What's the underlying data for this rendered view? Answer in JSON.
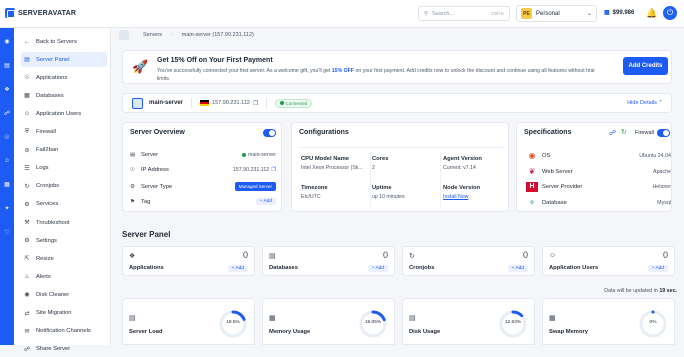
{
  "brand": {
    "name": "SERVERAVATAR",
    "accent": "#1d5bf5"
  },
  "topbar": {
    "search_placeholder": "Search...",
    "search_shortcut": "Ctrl+K",
    "account_initials": "PE",
    "account_name": "Personal",
    "credit": "$99.986"
  },
  "rail_icons": [
    "dashboard-icon",
    "servers-icon",
    "apps-icon",
    "git-icon",
    "globe-icon",
    "team-icon",
    "billing-icon",
    "integration-icon",
    "support-icon"
  ],
  "nav": [
    {
      "label": "Back to Servers",
      "icon": "arrow-left-icon"
    },
    {
      "label": "Server Panel",
      "icon": "server-icon",
      "active": true
    },
    {
      "label": "Applications",
      "icon": "globe-icon"
    },
    {
      "label": "Databases",
      "icon": "database-icon"
    },
    {
      "label": "Application Users",
      "icon": "users-icon"
    },
    {
      "label": "Firewall",
      "icon": "shield-icon"
    },
    {
      "label": "Fail2ban",
      "icon": "ban-icon"
    },
    {
      "label": "Logs",
      "icon": "logs-icon"
    },
    {
      "label": "Cronjobs",
      "icon": "refresh-icon"
    },
    {
      "label": "Services",
      "icon": "gear-icon"
    },
    {
      "label": "Troubleshoot",
      "icon": "wrench-icon"
    },
    {
      "label": "Settings",
      "icon": "settings-icon"
    },
    {
      "label": "Resize",
      "icon": "resize-icon"
    },
    {
      "label": "Alerts",
      "icon": "bell-icon"
    },
    {
      "label": "Disk Cleaner",
      "icon": "disk-icon"
    },
    {
      "label": "Site Migration",
      "icon": "migration-icon"
    },
    {
      "label": "Notification Channels",
      "icon": "channel-icon"
    },
    {
      "label": "Share Server",
      "icon": "share-icon"
    }
  ],
  "breadcrumbs": [
    "Servers",
    "main-server (157.90.231.112)"
  ],
  "promo": {
    "title": "Get 15% Off on Your First Payment",
    "desc_pre": "You've successfully connected your first server. As a welcome gift, you'll get ",
    "desc_bold": "15% OFF",
    "desc_post": " on your first payment. Add credits now to unlock the discount and continue using all features without trial limits.",
    "button": "Add Credits"
  },
  "server": {
    "name": "main-server",
    "ip": "157.90.231.112",
    "status": "Connected",
    "hide": "Hide Details"
  },
  "overview": {
    "title": "Server Overview",
    "rows": [
      {
        "label": "Server",
        "value": "main-server"
      },
      {
        "label": "IP Address",
        "value": "157.90.231.112"
      },
      {
        "label": "Server Type",
        "value": "Managed Server"
      },
      {
        "label": "Tag",
        "value": "+ Add"
      }
    ]
  },
  "configs": {
    "title": "Configurations",
    "items": [
      {
        "k": "CPU Model Name",
        "v": "Intel Xeon Processor (Sk..."
      },
      {
        "k": "Cores",
        "v": "2"
      },
      {
        "k": "Agent Version",
        "v": "Current: v7.14"
      },
      {
        "k": "Timezone",
        "v": "Etc/UTC"
      },
      {
        "k": "Uptime",
        "v": "up 10 minutes"
      },
      {
        "k": "Node Version",
        "v": "Install Now"
      }
    ]
  },
  "specs": {
    "title": "Specifications",
    "firewall": "Firewall",
    "items": [
      {
        "k": "OS",
        "v": "Ubuntu 24.04"
      },
      {
        "k": "Web Server",
        "v": "Apache"
      },
      {
        "k": "Server Provider",
        "v": "Hetzner"
      },
      {
        "k": "Database",
        "v": "Mysql"
      }
    ]
  },
  "panel": {
    "title": "Server Panel",
    "cards": [
      {
        "label": "Applications",
        "count": "0",
        "add": "+ Add"
      },
      {
        "label": "Databases",
        "count": "0",
        "add": "+ Add"
      },
      {
        "label": "Cronjobs",
        "count": "0",
        "add": "+ Add"
      },
      {
        "label": "Application Users",
        "count": "0",
        "add": "+ Add"
      }
    ]
  },
  "update": {
    "pre": "Data will be updated in ",
    "bold": "19 sec.",
    "post": ""
  },
  "gauges": [
    {
      "label": "Server Load",
      "value": "18.5%",
      "fraction": 0.185
    },
    {
      "label": "Memory Usage",
      "value": "19.05%",
      "fraction": 0.1905
    },
    {
      "label": "Disk Usage",
      "value": "12.63%",
      "fraction": 0.1263
    },
    {
      "label": "Swap Memory",
      "value": "0%",
      "fraction": 0
    }
  ]
}
